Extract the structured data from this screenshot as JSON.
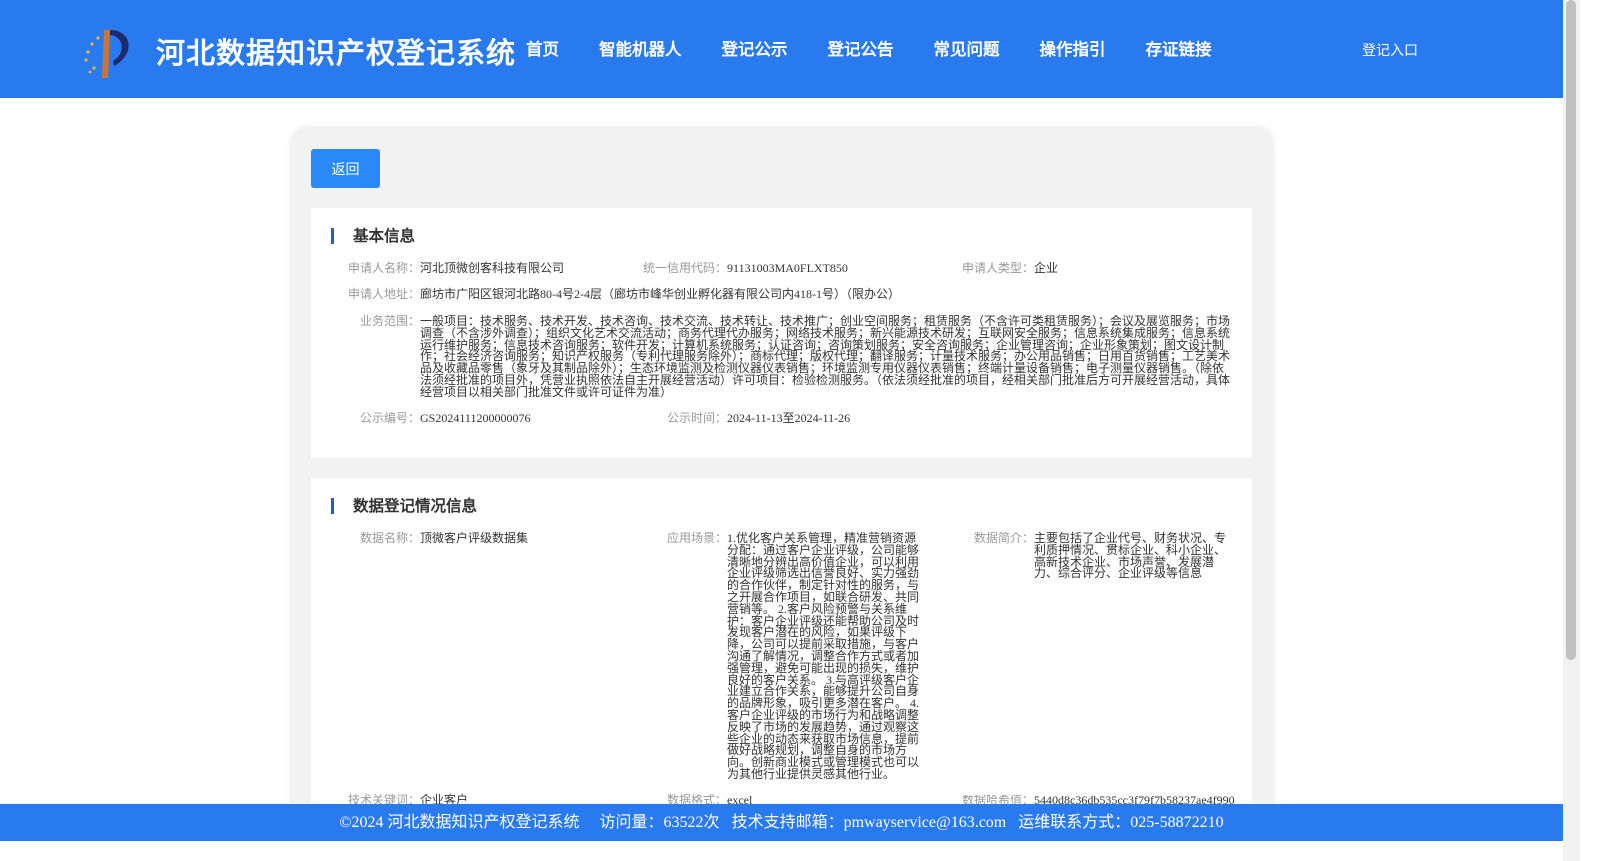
{
  "header": {
    "title": "河北数据知识产权登记系统",
    "nav": [
      "首页",
      "智能机器人",
      "登记公示",
      "登记公告",
      "常见问题",
      "操作指引",
      "存证链接"
    ],
    "login": "登记入口"
  },
  "back_label": "返回",
  "basic": {
    "title": "基本信息",
    "applicant_name": {
      "label": "申请人名称：",
      "value": "河北顶微创客科技有限公司"
    },
    "credit_code": {
      "label": "统一信用代码：",
      "value": "91131003MA0FLXT850"
    },
    "applicant_type": {
      "label": "申请人类型：",
      "value": "企业"
    },
    "address": {
      "label": "申请人地址：",
      "value": "廊坊市广阳区银河北路80-4号2-4层（廊坊市峰华创业孵化器有限公司内418-1号）（限办公）"
    },
    "scope": {
      "label": "业务范围：",
      "value": "一般项目：技术服务、技术开发、技术咨询、技术交流、技术转让、技术推广；创业空间服务；租赁服务（不含许可类租赁服务）；会议及展览服务；市场调查（不含涉外调查）；组织文化艺术交流活动；商务代理代办服务；网络技术服务；新兴能源技术研发；互联网安全服务；信息系统集成服务；信息系统运行维护服务；信息技术咨询服务；软件开发；计算机系统服务；认证咨询；咨询策划服务；安全咨询服务；企业管理咨询；企业形象策划；图文设计制作；社会经济咨询服务；知识产权服务（专利代理服务除外）；商标代理；版权代理；翻译服务；计量技术服务；办公用品销售；日用百货销售；工艺美术品及收藏品零售（象牙及其制品除外）；生态环境监测及检测仪器仪表销售；环境监测专用仪器仪表销售；终端计量设备销售；电子测量仪器销售。（除依法须经批准的项目外，凭营业执照依法自主开展经营活动）许可项目：检验检测服务。（依法须经批准的项目，经相关部门批准后方可开展经营活动，具体经营项目以相关部门批准文件或许可证件为准）"
    },
    "notice_no": {
      "label": "公示编号：",
      "value": "GS2024111200000076"
    },
    "notice_time": {
      "label": "公示时间：",
      "value": "2024-11-13至2024-11-26"
    }
  },
  "data_section": {
    "title": "数据登记情况信息",
    "data_name": {
      "label": "数据名称：",
      "value": "顶微客户评级数据集"
    },
    "scenario": {
      "label": "应用场景：",
      "value": "1.优化客户关系管理，精准营销资源分配：通过客户企业评级，公司能够清晰地分辨出高价值企业，可以利用企业评级筛选出信誉良好、实力强劲的合作伙伴，制定针对性的服务，与之开展合作项目，如联合研发、共同营销等。 2.客户风险预警与关系维护：客户企业评级还能帮助公司及时发现客户潜在的风险，如果评级下降，公司可以提前采取措施，与客户沟通了解情况，调整合作方式或者加强管理，避免可能出现的损失，维护良好的客户关系。 3.与高评级客户企业建立合作关系，能够提升公司自身的品牌形象，吸引更多潜在客户。 4.客户企业评级的市场行为和战略调整反映了市场的发展趋势，通过观察这些企业的动态来获取市场信息，提前做好战略规划，调整自身的市场方向。创新商业模式或管理模式也可以为其他行业提供灵感其他行业。"
    },
    "summary": {
      "label": "数据简介：",
      "value": "主要包括了企业代号、财务状况、专利质押情况、贯标企业、科小企业、高新技术企业、市场声誉、发展潜力、综合评分、企业评级等信息"
    },
    "keywords": {
      "label": "技术关键词：",
      "value": "企业客户"
    },
    "format": {
      "label": "数据格式：",
      "value": "excel"
    },
    "hash": {
      "label": "数据哈希值：",
      "value": "5440d8c36db535cc3f79f7b58237ae4f990"
    }
  },
  "footer": {
    "copyright": "©2024 河北数据知识产权登记系统",
    "visits": "访问量：63522次",
    "email": "技术支持邮箱：pmwayservice@163.com",
    "contact": "运维联系方式：025-58872210"
  },
  "colors": {
    "primary": "#2979ef",
    "button": "#2989f7",
    "accent_bar": "#1f5fbf",
    "card_bg": "#f2f2f2"
  }
}
